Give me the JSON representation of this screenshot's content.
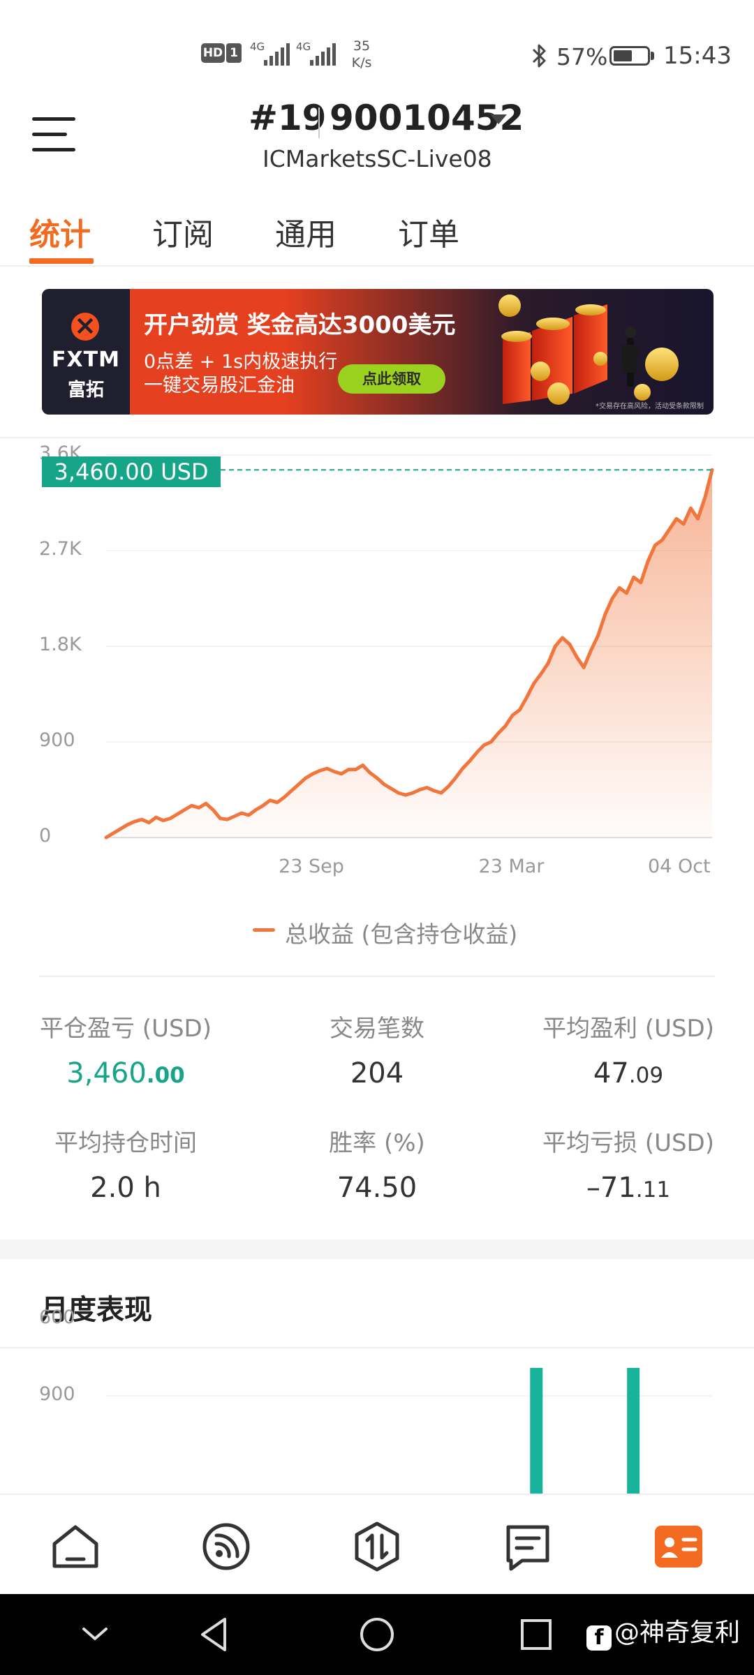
{
  "status_bar": {
    "hd": "HD",
    "sim": "1",
    "net1": "4G",
    "net2": "4G",
    "speed_value": "35",
    "speed_unit": "K/s",
    "battery_pct": "57%",
    "battery_level": 0.57,
    "time": "15:43"
  },
  "header": {
    "title": "#19",
    "account": "90010452",
    "server": "ICMarketsSC-Live08"
  },
  "tabs": [
    {
      "label": "统计",
      "active": true
    },
    {
      "label": "订阅",
      "active": false
    },
    {
      "label": "通用",
      "active": false
    },
    {
      "label": "订单",
      "active": false
    }
  ],
  "banner": {
    "logo_text": "FXTM",
    "logo_cn": "富拓",
    "headline": "开户劲赏 奖金高达3000美元",
    "line1": "0点差 + 1s内极速执行",
    "line2": "一键交易股汇金油",
    "cta": "点此领取",
    "note": "*交易存在高风险，活动受条款限制"
  },
  "chart_data": {
    "type": "area",
    "legend": "总收益 (包含持仓收益)",
    "current_value_label": "3,460.00 USD",
    "y_ticks": [
      "0",
      "900",
      "1.8K",
      "2.7K",
      "3.6K"
    ],
    "ylim": [
      0,
      3600
    ],
    "x_ticks": [
      "23 Sep",
      "23 Mar",
      "04 Oct"
    ],
    "x_tick_positions": [
      0.34,
      0.67,
      1.0
    ],
    "line_color": "#f0763d",
    "tag_color": "#17a589",
    "series": [
      {
        "values": [
          0,
          40,
          80,
          120,
          150,
          170,
          140,
          190,
          160,
          180,
          220,
          260,
          300,
          280,
          320,
          260,
          180,
          170,
          200,
          230,
          210,
          260,
          300,
          350,
          330,
          380,
          440,
          500,
          560,
          600,
          630,
          650,
          620,
          600,
          640,
          640,
          680,
          610,
          560,
          500,
          460,
          420,
          400,
          420,
          450,
          470,
          440,
          420,
          480,
          560,
          650,
          720,
          800,
          870,
          900,
          980,
          1050,
          1150,
          1200,
          1320,
          1450,
          1540,
          1640,
          1800,
          1880,
          1820,
          1700,
          1600,
          1760,
          1900,
          2100,
          2250,
          2350,
          2300,
          2450,
          2400,
          2600,
          2750,
          2800,
          2900,
          3000,
          2950,
          3100,
          3000,
          3200,
          3460
        ]
      }
    ]
  },
  "stats": [
    {
      "label": "平仓盈亏 (USD)",
      "int": "3,460",
      "dec": ".00",
      "green": true
    },
    {
      "label": "交易笔数",
      "int": "204",
      "dec": "",
      "green": false
    },
    {
      "label": "平均盈利 (USD)",
      "int": "47",
      "dec": ".09",
      "green": false
    },
    {
      "label": "平均持仓时间",
      "int": "2.0 h",
      "dec": "",
      "green": false
    },
    {
      "label": "胜率 (%)",
      "int": "74.50",
      "dec": "",
      "green": false
    },
    {
      "label": "平均亏损 (USD)",
      "int": "–71",
      "dec": ".11",
      "green": false
    }
  ],
  "monthly": {
    "title": "月度表现",
    "y_ticks": [
      "900",
      "600"
    ],
    "visible_ylim": [
      400,
      900
    ],
    "bars": [
      {
        "x_fraction": 0.71,
        "value": 665
      },
      {
        "x_fraction": 0.87,
        "value": 590
      }
    ],
    "bar_color": "#17b39a"
  },
  "bottom_nav": [
    {
      "name": "home",
      "active": false
    },
    {
      "name": "signals",
      "active": false
    },
    {
      "name": "trade",
      "active": false
    },
    {
      "name": "news",
      "active": false
    },
    {
      "name": "profile",
      "active": true
    }
  ],
  "accent_color": "#f26b21",
  "watermark": "@神奇复利"
}
